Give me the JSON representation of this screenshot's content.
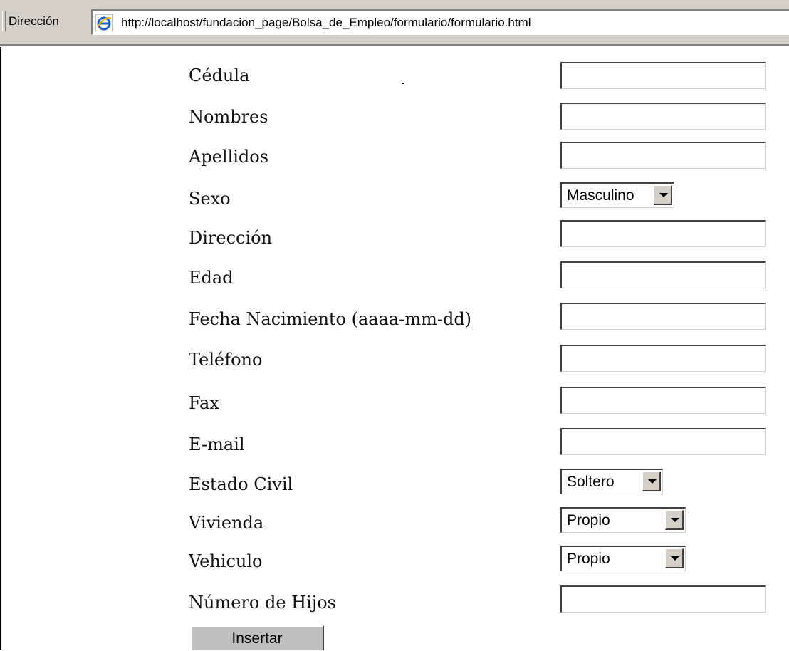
{
  "address_bar": {
    "label": "Dirección",
    "url": "http://localhost/fundacion_page/Bolsa_de_Empleo/formulario/formulario.html"
  },
  "form": {
    "fields": [
      {
        "label": "Cédula",
        "type": "text",
        "value": ""
      },
      {
        "label": "Nombres",
        "type": "text",
        "value": ""
      },
      {
        "label": "Apellidos",
        "type": "text",
        "value": ""
      },
      {
        "label": "Sexo",
        "type": "select",
        "value": "Masculino"
      },
      {
        "label": "Dirección",
        "type": "text",
        "value": ""
      },
      {
        "label": "Edad",
        "type": "text",
        "value": ""
      },
      {
        "label": "Fecha Nacimiento (aaaa-mm-dd)",
        "type": "text",
        "value": ""
      },
      {
        "label": "Teléfono",
        "type": "text",
        "value": ""
      },
      {
        "label": "Fax",
        "type": "text",
        "value": ""
      },
      {
        "label": "E-mail",
        "type": "text",
        "value": ""
      },
      {
        "label": "Estado Civil",
        "type": "select",
        "value": "Soltero"
      },
      {
        "label": "Vivienda",
        "type": "select",
        "value": "Propio"
      },
      {
        "label": "Vehiculo",
        "type": "select",
        "value": "Propio"
      },
      {
        "label": "Número de Hijos",
        "type": "text",
        "value": ""
      }
    ],
    "submit_label": "Insertar"
  }
}
